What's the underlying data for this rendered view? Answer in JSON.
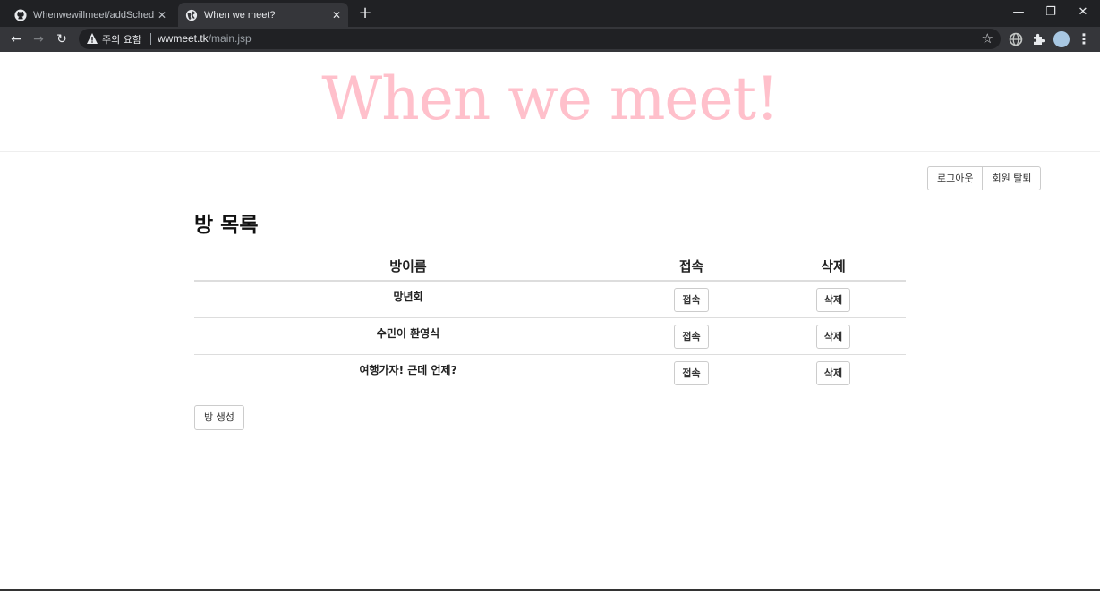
{
  "browser": {
    "tabs": [
      {
        "title": "Whenwewillmeet/addSchedule.j",
        "icon": "github-icon",
        "active": false,
        "close_label": "✕"
      },
      {
        "title": "When we meet?",
        "icon": "globe-icon",
        "active": true,
        "close_label": "✕"
      }
    ],
    "new_tab_label": "+",
    "window_controls": {
      "minimize": "—",
      "restore": "❐",
      "close": "✕"
    },
    "nav": {
      "back": "←",
      "forward": "→",
      "reload": "↻"
    },
    "omnibox": {
      "security_label": "주의 요함",
      "url_host": "wwmeet.tk",
      "url_path": "/main.jsp",
      "bookmark_icon": "☆"
    },
    "menu_icon": "⋮"
  },
  "site": {
    "title": "When we meet!",
    "title_color": "#ffc0cb"
  },
  "account": {
    "logout_label": "로그아웃",
    "withdraw_label": "회원 탈퇴"
  },
  "rooms": {
    "heading": "방 목록",
    "columns": {
      "name": "방이름",
      "join": "접속",
      "delete": "삭제"
    },
    "rows": [
      {
        "name": "망년회",
        "join_label": "접속",
        "delete_label": "삭제"
      },
      {
        "name": "수민이 환영식",
        "join_label": "접속",
        "delete_label": "삭제"
      },
      {
        "name": "여행가자! 근데 언제?",
        "join_label": "접속",
        "delete_label": "삭제"
      }
    ],
    "create_label": "방 생성"
  }
}
